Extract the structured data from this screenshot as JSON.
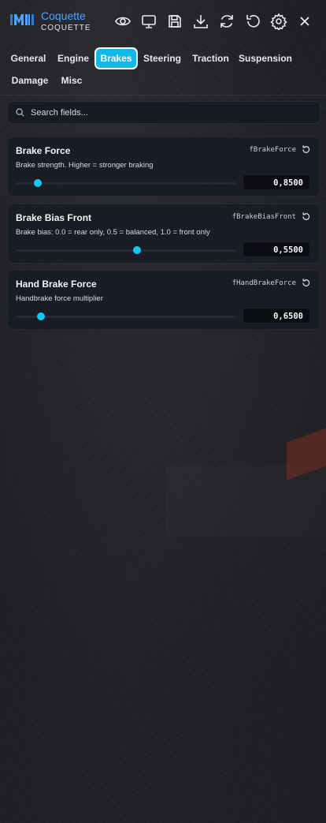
{
  "header": {
    "title": "Coquette",
    "subtitle": "COQUETTE",
    "icons": [
      "eye-icon",
      "monitor-icon",
      "save-icon",
      "download-icon",
      "refresh-icon",
      "undo-icon",
      "gear-icon",
      "close-icon"
    ]
  },
  "tabs": [
    {
      "label": "General"
    },
    {
      "label": "Engine"
    },
    {
      "label": "Brakes",
      "active": true
    },
    {
      "label": "Steering"
    },
    {
      "label": "Traction"
    },
    {
      "label": "Suspension"
    },
    {
      "label": "Damage"
    },
    {
      "label": "Misc"
    }
  ],
  "search": {
    "placeholder": "Search fields..."
  },
  "fields": [
    {
      "title": "Brake Force",
      "key": "fBrakeForce",
      "description": "Brake strength. Higher = stronger braking",
      "value": "0,8500",
      "slider_fraction": 0.1
    },
    {
      "title": "Brake Bias Front",
      "key": "fBrakeBiasFront",
      "description": "Brake bias: 0.0 = rear only, 0.5 = balanced, 1.0 = front only",
      "value": "0,5500",
      "slider_fraction": 0.55
    },
    {
      "title": "Hand Brake Force",
      "key": "fHandBrakeForce",
      "description": "Handbrake force multiplier",
      "value": "0,6500",
      "slider_fraction": 0.115
    }
  ],
  "colors": {
    "accent": "#14c8f5",
    "brand": "#4ea3ff",
    "active_tab": "#14b8e8"
  }
}
